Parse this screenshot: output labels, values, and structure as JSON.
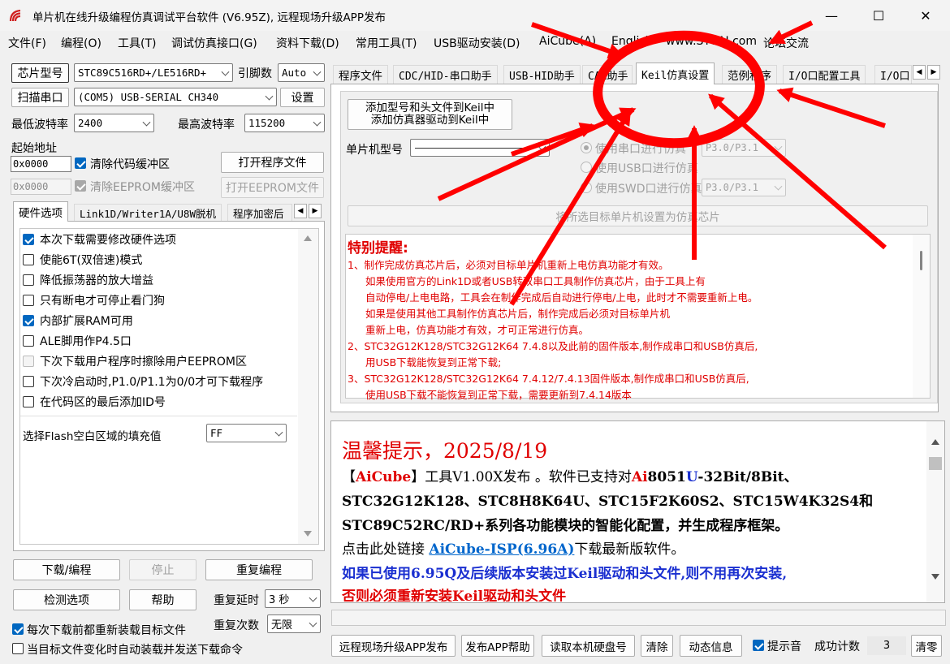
{
  "window": {
    "title": "单片机在线升级编程仿真调试平台软件 (V6.95Z), 远程现场升级APP发布",
    "minimize": "—",
    "maximize": "☐",
    "close": "✕"
  },
  "menu": [
    "文件(F)",
    "编程(O)",
    "工具(T)",
    "调试仿真接口(G)",
    "资料下载(D)",
    "常用工具(T)",
    "USB驱动安装(D)",
    "AiCube(A)",
    "English",
    "www.STCAI.com",
    "论坛交流"
  ],
  "left": {
    "chip_button": "芯片型号",
    "chip_value": "STC89C516RD+/LE516RD+",
    "pin_label": "引脚数",
    "pin_value": "Auto",
    "scan_button": "扫描串口",
    "port_value": "(COM5) USB-SERIAL CH340",
    "settings_button": "设置",
    "min_baud_label": "最低波特率",
    "min_baud_value": "2400",
    "max_baud_label": "最高波特率",
    "max_baud_value": "115200",
    "start_addr_label": "起始地址",
    "code_addr": "0x0000",
    "clear_code_label": "清除代码缓冲区",
    "open_program_button": "打开程序文件",
    "eeprom_addr": "0x0000",
    "clear_eeprom_label": "清除EEPROM缓冲区",
    "open_eeprom_button": "打开EEPROM文件",
    "tabs": [
      "硬件选项",
      "Link1D/Writer1A/U8W脱机",
      "程序加密后"
    ],
    "hw_options": [
      {
        "label": "本次下载需要修改硬件选项",
        "checked": true,
        "disabled": false
      },
      {
        "label": "使能6T(双倍速)模式",
        "checked": false,
        "disabled": false
      },
      {
        "label": "降低振荡器的放大增益",
        "checked": false,
        "disabled": false
      },
      {
        "label": "只有断电才可停止看门狗",
        "checked": false,
        "disabled": false
      },
      {
        "label": "内部扩展RAM可用",
        "checked": true,
        "disabled": false
      },
      {
        "label": "ALE脚用作P4.5口",
        "checked": false,
        "disabled": false
      },
      {
        "label": "下次下载用户程序时擦除用户EEPROM区",
        "checked": false,
        "disabled": true
      },
      {
        "label": "下次冷启动时,P1.0/P1.1为0/0才可下载程序",
        "checked": false,
        "disabled": false
      },
      {
        "label": "在代码区的最后添加ID号",
        "checked": false,
        "disabled": false
      }
    ],
    "flash_fill_label": "选择Flash空白区域的填充值",
    "flash_fill_value": "FF",
    "download_button": "下载/编程",
    "stop_button": "停止",
    "reprogram_button": "重复编程",
    "check_button": "检测选项",
    "help_button": "帮助",
    "repeat_delay_label": "重复延时",
    "repeat_delay_value": "3 秒",
    "repeat_count_label": "重复次数",
    "repeat_count_value": "无限",
    "reload_label": "每次下载前都重新装载目标文件",
    "auto_send_label": "当目标文件变化时自动装载并发送下载命令"
  },
  "right_tabs": [
    "程序文件",
    "CDC/HID-串口助手",
    "USB-HID助手",
    "CAN助手",
    "Keil仿真设置",
    "范例程序",
    "I/O口配置工具",
    "I/O口"
  ],
  "keil": {
    "add_button_line1": "添加型号和头文件到Keil中",
    "add_button_line2": "添加仿真器驱动到Keil中",
    "mcu_label": "单片机型号",
    "mcu_value": "",
    "radio_serial": "使用串口进行仿真",
    "serial_pins": "P3.0/P3.1",
    "radio_usb": "使用USB口进行仿真",
    "radio_swd": "使用SWD口进行仿真",
    "swd_pins": "P3.0/P3.1",
    "set_button": "将所选目标单片机设置为仿真芯片"
  },
  "notice": {
    "heading": "特别提醒:",
    "lines": [
      "1、制作完成仿真芯片后，必须对目标单片机重新上电仿真功能才有效。",
      "如果使用官方的Link1D或者USB转双串口工具制作仿真芯片，由于工具上有",
      "自动停电/上电电路，工具会在制作完成后自动进行停电/上电，此时才不需要重新上电。",
      "如果是使用其他工具制作仿真芯片后，制作完成后必须对目标单片机",
      "重新上电，仿真功能才有效，才可正常进行仿真。",
      "2、STC32G12K128/STC32G12K64   7.4.8以及此前的固件版本,制作成串口和USB仿真后,",
      "用USB下载能恢复到正常下载;",
      "3、STC32G12K128/STC32G12K64   7.4.12/7.4.13固件版本,制作成串口和USB仿真后,",
      "使用USB下载不能恢复到正常下载，需要更新到7.4.14版本"
    ]
  },
  "tips": {
    "title": "温馨提示，2025/8/19",
    "l1_a": "【",
    "l1_b": "AiCube",
    "l1_c": "】工具V1.00X发布 。软件已支持对",
    "l1_d": "Ai",
    "l1_e": "8051",
    "l1_f": "U",
    "l1_g": "-32Bit/8Bit、",
    "l2": "STC32G12K128、STC8H8K64U、STC15F2K60S2、STC15W4K32S4和",
    "l3": "STC89C52RC/RD+系列各功能模块的智能化配置，并生成程序框架。",
    "l4_a": "点击此处链接 ",
    "l4_link": "AiCube-ISP(6.96A)",
    "l4_b": "下载最新版软件。",
    "l5": "如果已使用6.95Q及后续版本安装过Keil驱动和头文件,则不用再次安装,",
    "l6": "否则必须重新安装Keil驱动和头文件"
  },
  "bottom": {
    "remote_button": "远程现场升级APP发布",
    "app_help_button": "发布APP帮助",
    "read_disk_button": "读取本机硬盘号",
    "clear_button": "清除",
    "dynamic_button": "动态信息",
    "sound_label": "提示音",
    "count_label": "成功计数",
    "count_value": "3",
    "reset_button": "清零"
  },
  "colors": {
    "annotation_red": "#ff0000",
    "notice_red": "#e00000",
    "link_blue": "#0066cc",
    "checkbox_blue": "#0067c0"
  }
}
